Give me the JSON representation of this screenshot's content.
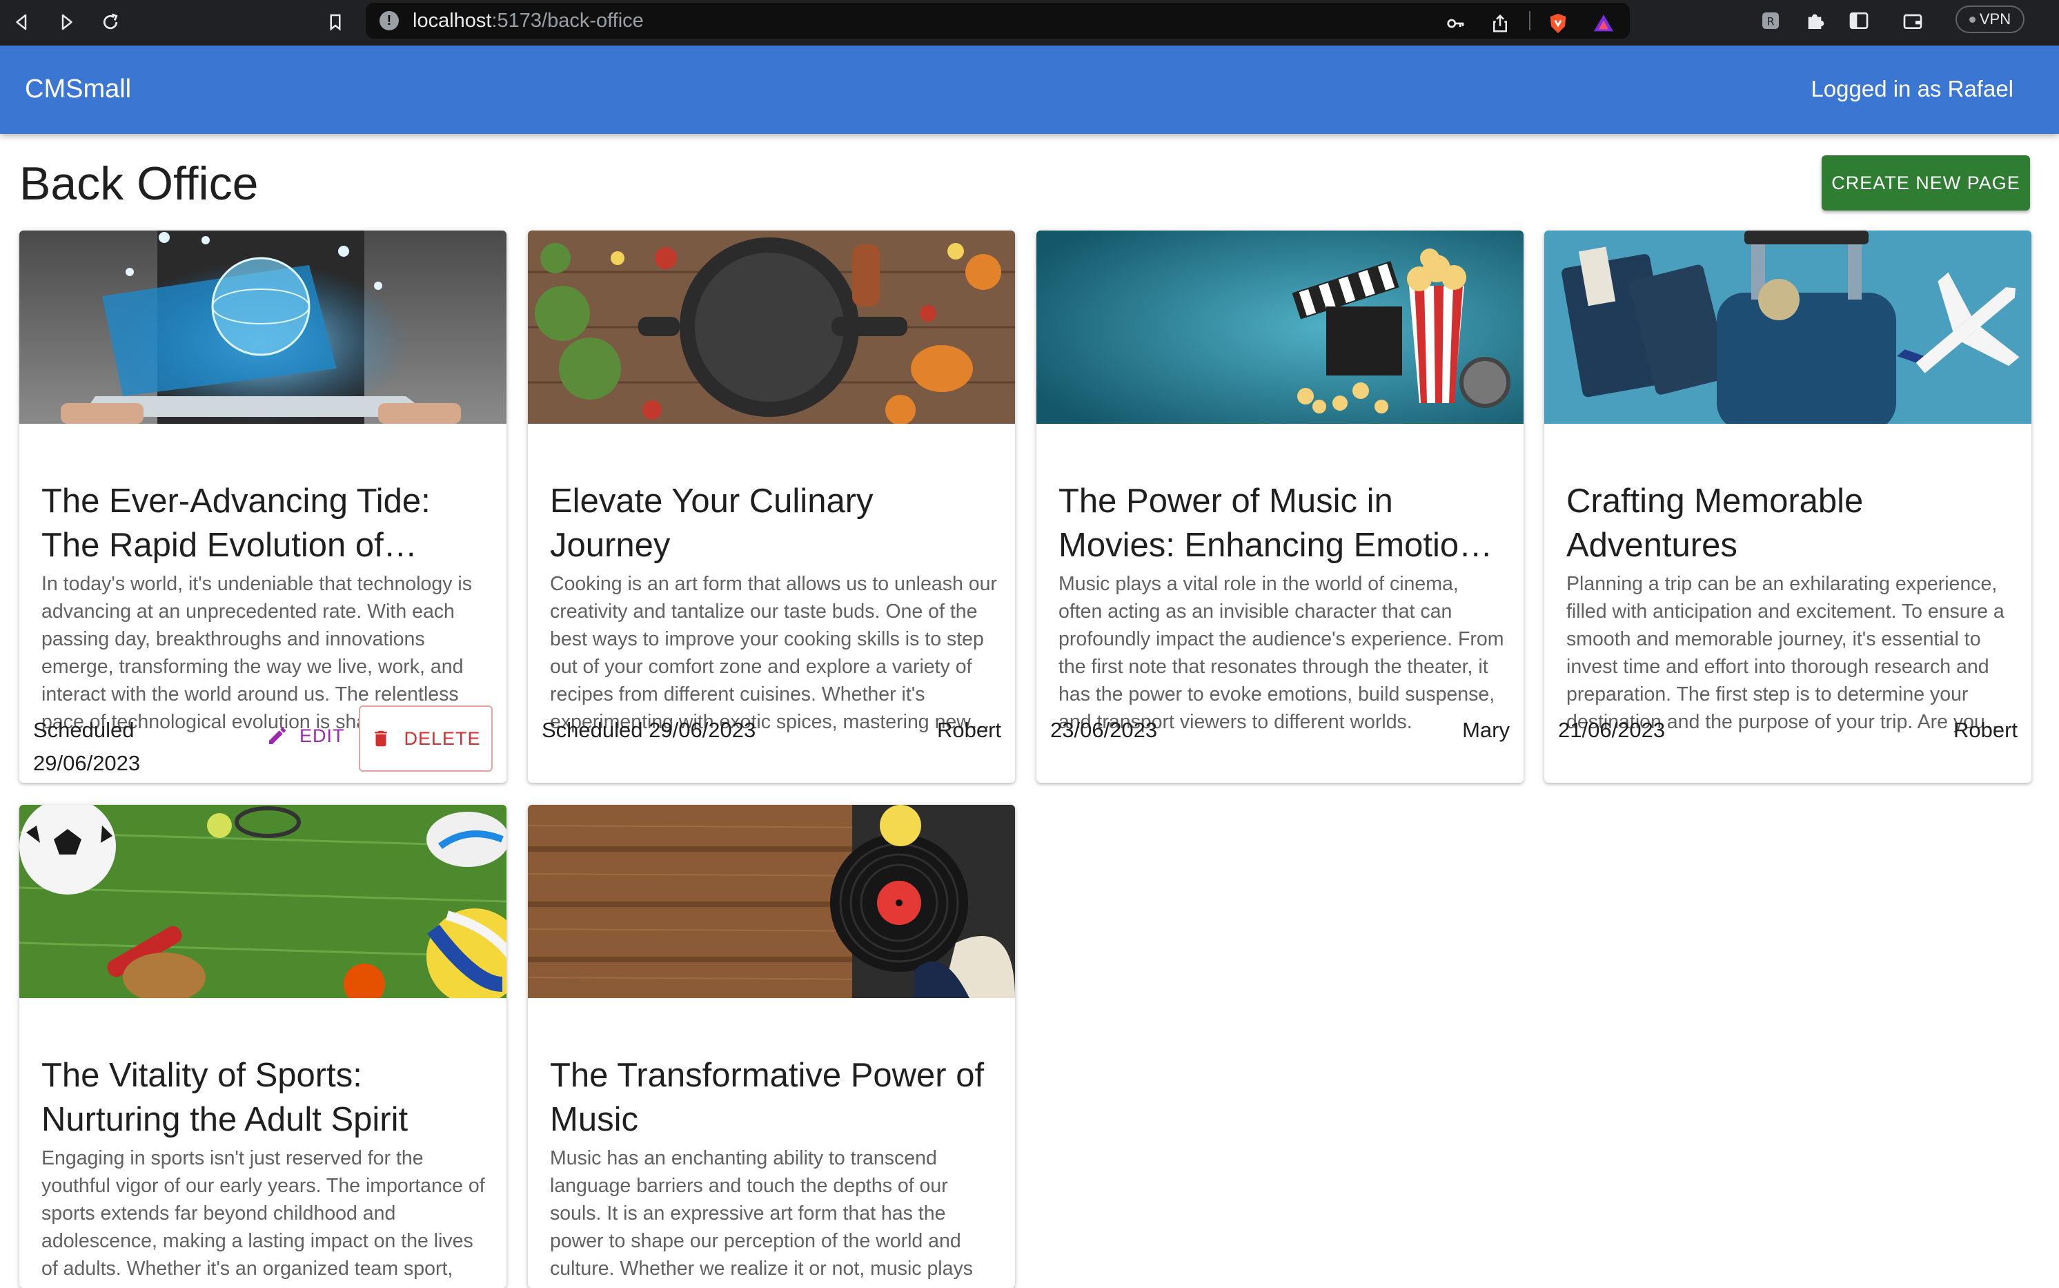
{
  "browser": {
    "url_host": "localhost",
    "url_path": ":5173/back-office",
    "vpn_label": "VPN"
  },
  "app": {
    "brand": "CMSmall",
    "logged_prefix": "Logged in as ",
    "logged_user": "Rafael"
  },
  "page": {
    "title": "Back Office",
    "create_button": "CREATE NEW PAGE"
  },
  "actions": {
    "edit": "EDIT",
    "delete": "DELETE"
  },
  "cards": [
    {
      "image": "technology-laptop-globe",
      "title": "The Ever-Advancing Tide: The Rapid Evolution of Technology",
      "excerpt": "In today's world, it's undeniable that technology is advancing at an unprecedented rate. With each passing day, breakthroughs and innovations emerge, transforming the way we live, work, and interact with the world around us. The relentless pace of technological evolution is shaping our future.",
      "status": "Scheduled 29/06/2023",
      "author": ""
    },
    {
      "image": "cooking-pan-ingredients",
      "title": "Elevate Your Culinary Journey",
      "excerpt": "Cooking is an art form that allows us to unleash our creativity and tantalize our taste buds. One of the best ways to improve your cooking skills is to step out of your comfort zone and explore a variety of recipes from different cuisines. Whether it's experimenting with exotic spices, mastering new techniques.",
      "status": "Scheduled 29/06/2023",
      "author": "Robert"
    },
    {
      "image": "movie-popcorn-clapperboard",
      "title": "The Power of Music in Movies: Enhancing Emotional Impact",
      "excerpt": "Music plays a vital role in the world of cinema, often acting as an invisible character that can profoundly impact the audience's experience. From the first note that resonates through the theater, it has the power to evoke emotions, build suspense, and transport viewers to different worlds.",
      "status": "23/06/2023",
      "author": "Mary"
    },
    {
      "image": "travel-suitcase-airplane",
      "title": "Crafting Memorable Adventures",
      "excerpt": "Planning a trip can be an exhilarating experience, filled with anticipation and excitement. To ensure a smooth and memorable journey, it's essential to invest time and effort into thorough research and preparation. The first step is to determine your destination and the purpose of your trip. Are you looking.",
      "status": "21/06/2023",
      "author": "Robert"
    },
    {
      "image": "sports-balls-grass",
      "title": "The Vitality of Sports: Nurturing the Adult Spirit",
      "excerpt": "Engaging in sports isn't just reserved for the youthful vigor of our early years. The importance of sports extends far beyond childhood and adolescence, making a lasting impact on the lives of adults. Whether it's an organized team sport,",
      "status": "",
      "author": ""
    },
    {
      "image": "vinyl-record-wood",
      "title": "The Transformative Power of Music",
      "excerpt": "Music has an enchanting ability to transcend language barriers and touch the depths of our souls. It is an expressive art form that has the power to shape our perception of the world and culture. Whether we realize it or not, music plays",
      "status": "",
      "author": ""
    }
  ],
  "colors": {
    "app_bar": "#3b76d3",
    "create_button": "#2e7d32",
    "edit": "#9c27b0",
    "delete": "#d32f2f"
  }
}
